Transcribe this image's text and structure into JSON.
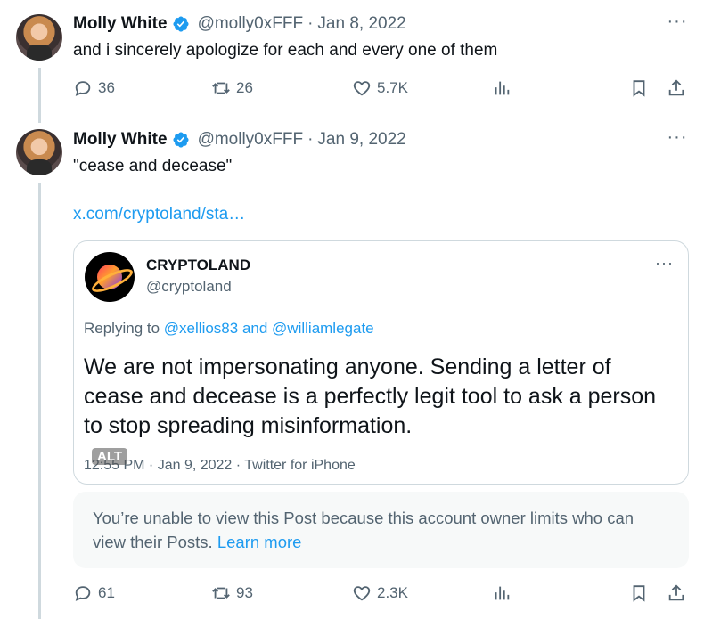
{
  "tweets": [
    {
      "author": "Molly White",
      "handle": "@molly0xFFF",
      "date": "Jan 8, 2022",
      "text": "and i sincerely apologize for each and every one of them",
      "stats": {
        "replies": "36",
        "retweets": "26",
        "likes": "5.7K"
      }
    },
    {
      "author": "Molly White",
      "handle": "@molly0xFFF",
      "date": "Jan 9, 2022",
      "text": "\"cease and decease\"",
      "link": "x.com/cryptoland/sta…",
      "stats": {
        "replies": "61",
        "retweets": "93",
        "likes": "2.3K"
      }
    }
  ],
  "quote": {
    "name": "CRYPTOLAND",
    "handle": "@cryptoland",
    "replying_prefix": "Replying to",
    "mention1": "@xellios83",
    "and": "and",
    "mention2": "@williamlegate",
    "body": "We are not impersonating anyone. Sending a letter of cease and decease is a perfectly legit tool to ask a person to stop spreading misinformation.",
    "meta": "12:55 PM · Jan 9, 2022 · Twitter for iPhone",
    "alt": "ALT"
  },
  "unavailable": {
    "message": "You’re unable to view this Post because this account owner limits who can view their Posts.",
    "learn_more": "Learn more"
  },
  "separator": "·",
  "more": "···",
  "colors": {
    "link": "#1d9bf0",
    "muted": "#536471",
    "verified": "#1d9bf0"
  }
}
